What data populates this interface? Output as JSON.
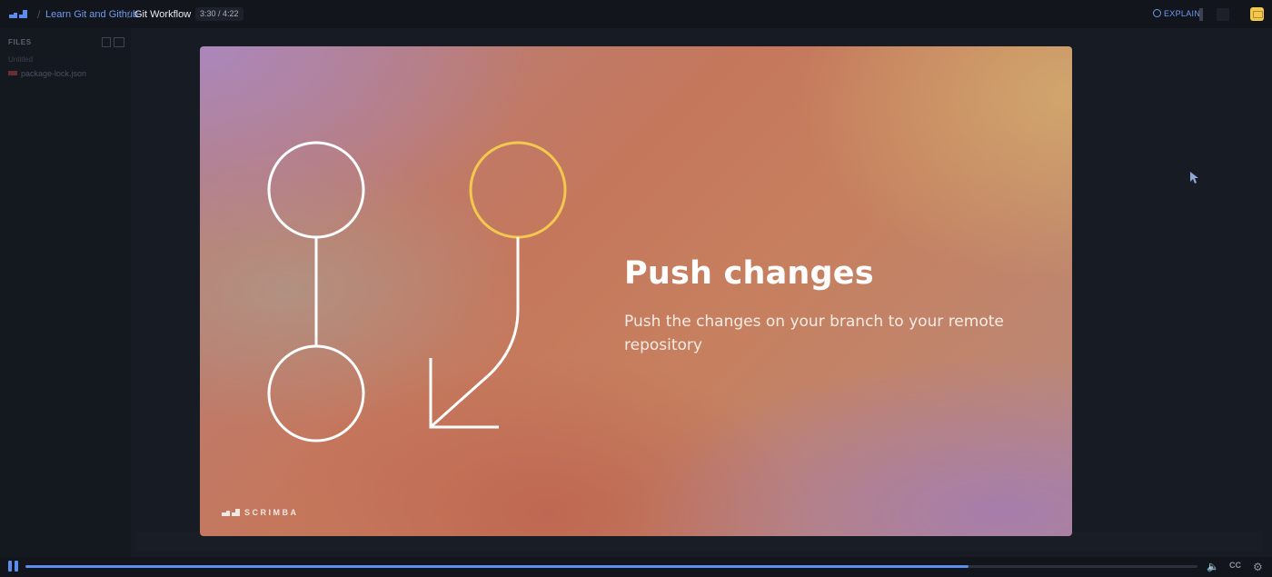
{
  "header": {
    "breadcrumb_course": "Learn Git and Github",
    "breadcrumb_lesson": "Git Workflow",
    "time": "3:30 / 4:22",
    "explain_label": "EXPLAIN"
  },
  "sidebar": {
    "files_label": "FILES",
    "folder": "Untitled",
    "files": [
      {
        "name": "package-lock.json",
        "icon": "json-file-icon"
      }
    ]
  },
  "slide": {
    "title": "Push changes",
    "subtitle": "Push the changes on your branch to your remote repository",
    "brand": "SCRIMBA",
    "colors": {
      "accent_circle": "#f2c94c",
      "line": "#ffffff"
    }
  },
  "player": {
    "progress": 0.8046,
    "cc_label": "CC"
  },
  "colors": {
    "accent": "#5b8def",
    "background": "#12151c"
  }
}
